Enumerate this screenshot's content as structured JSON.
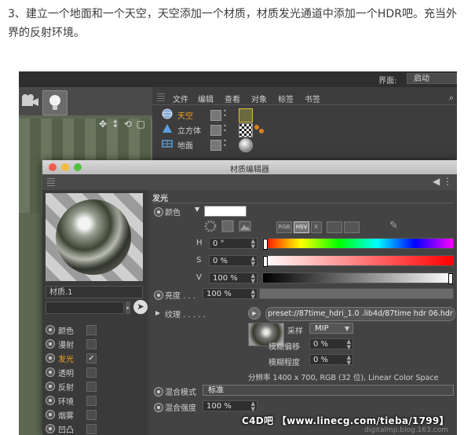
{
  "article": {
    "paragraph": "3、建立一个地面和一个天空，天空添加一个材质，材质发光通道中添加一个HDR吧。充当外界的反射环境。"
  },
  "app": {
    "layout_label": "界面:",
    "layout_value": "启动"
  },
  "object_manager": {
    "menu": [
      "文件",
      "编辑",
      "查看",
      "对象",
      "标签",
      "书签"
    ],
    "objects": [
      {
        "name": "天空",
        "color": "#f0a020",
        "icon": "sky-sphere-icon"
      },
      {
        "name": "立方体",
        "color": "#d0d0d0",
        "icon": "cube-icon"
      },
      {
        "name": "地面",
        "color": "#d0d0d0",
        "icon": "floor-icon"
      }
    ]
  },
  "material_editor": {
    "title": "材质编辑器",
    "material_name": "材质.1",
    "channels": [
      {
        "name": "颜色",
        "checked": false,
        "active": false
      },
      {
        "name": "漫射",
        "checked": false,
        "active": false
      },
      {
        "name": "发光",
        "checked": true,
        "active": true
      },
      {
        "name": "透明",
        "checked": false,
        "active": false
      },
      {
        "name": "反射",
        "checked": false,
        "active": false
      },
      {
        "name": "环境",
        "checked": false,
        "active": false
      },
      {
        "name": "烟雾",
        "checked": false,
        "active": false
      },
      {
        "name": "凹凸",
        "checked": false,
        "active": false
      }
    ],
    "check_mark": "✓",
    "section_title": "发光",
    "color_label": "颜色",
    "color_value": "#ffffff",
    "color_modes": [
      "RGB",
      "HSV",
      "K",
      "",
      ""
    ],
    "h_label": "H",
    "h_value": "0 °",
    "s_label": "S",
    "s_value": "0 %",
    "v_label": "V",
    "v_value": "100 %",
    "brightness_label": "亮度 . . .",
    "brightness_value": "100 %",
    "texture_label": "纹理 . . . . .",
    "texture_path": "preset://87time_hdri_1.0 .lib4d/87time hdr 06.hdr",
    "sampling_label": "采样",
    "sampling_value": "MIP",
    "blur_offset_label": "模糊偏移",
    "blur_offset_value": "0 %",
    "blur_scale_label": "模糊程度",
    "blur_scale_value": "0 %",
    "resolution_info": "分辨率 1400 x 700, RGB (32 位), Linear Color Space",
    "mix_mode_label": "混合模式",
    "mix_mode_value": "标准",
    "mix_strength_label": "混合强度",
    "mix_strength_value": "100 %"
  },
  "watermark": "C4D吧 【www.linecg.com/tieba/1799】",
  "blog_text": "digitalmp.blog.163.com"
}
